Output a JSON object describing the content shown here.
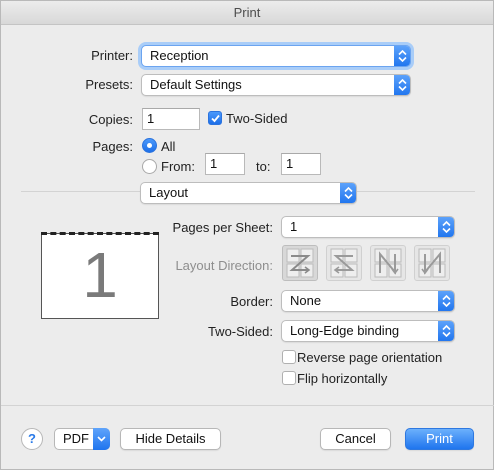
{
  "window": {
    "title": "Print"
  },
  "printer": {
    "label": "Printer:",
    "value": "Reception"
  },
  "presets": {
    "label": "Presets:",
    "value": "Default Settings"
  },
  "copies": {
    "label": "Copies:",
    "value": "1",
    "two_sided_label": "Two-Sided",
    "two_sided_checked": true
  },
  "pages": {
    "label": "Pages:",
    "all_label": "All",
    "from_label": "From:",
    "from_value": "1",
    "to_label": "to:",
    "to_value": "1",
    "selected": "All"
  },
  "section_popup": {
    "value": "Layout"
  },
  "preview": {
    "page_number": "1"
  },
  "layout": {
    "pages_per_sheet_label": "Pages per Sheet:",
    "pages_per_sheet_value": "1",
    "layout_direction_label": "Layout Direction:",
    "layout_direction_icons": [
      "z-right-icon",
      "z-left-icon",
      "n-down-icon",
      "n-down-reverse-icon"
    ],
    "border_label": "Border:",
    "border_value": "None",
    "two_sided_label": "Two-Sided:",
    "two_sided_value": "Long-Edge binding",
    "reverse_label": "Reverse page orientation",
    "reverse_checked": false,
    "flip_label": "Flip horizontally",
    "flip_checked": false
  },
  "footer": {
    "help_label": "?",
    "pdf_label": "PDF",
    "hide_details_label": "Hide Details",
    "cancel_label": "Cancel",
    "print_label": "Print"
  },
  "colors": {
    "accent": "#1f74ee",
    "focus_ring": "#a9cdf8",
    "background": "#ececec"
  }
}
